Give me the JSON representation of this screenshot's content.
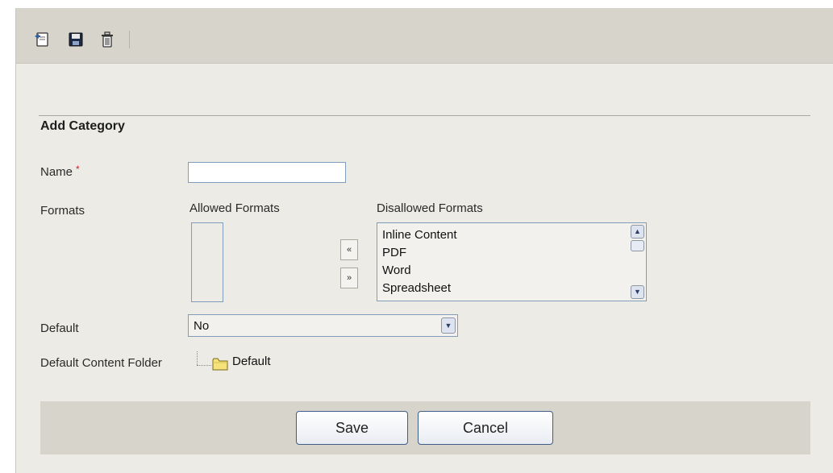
{
  "toolbar": {
    "icons": [
      "back-icon",
      "save-icon",
      "delete-icon"
    ]
  },
  "form": {
    "title": "Add Category",
    "name": {
      "label": "Name",
      "required_marker": "*",
      "value": ""
    },
    "formats": {
      "label": "Formats",
      "allowed_title": "Allowed Formats",
      "allowed_items": [],
      "disallowed_title": "Disallowed Formats",
      "disallowed_items": [
        "Inline Content",
        "PDF",
        "Word",
        "Spreadsheet"
      ],
      "move_left_label": "«",
      "move_right_label": "»"
    },
    "default": {
      "label": "Default",
      "selected": "No"
    },
    "folder": {
      "label": "Default Content Folder",
      "tree_item": "Default"
    }
  },
  "buttons": {
    "save_label": "Save",
    "cancel_label": "Cancel"
  },
  "colors": {
    "toolbar_bg": "#d6d4cb",
    "page_bg": "#ecebe6",
    "required": "#cc2222",
    "border": "#7f9db9"
  }
}
